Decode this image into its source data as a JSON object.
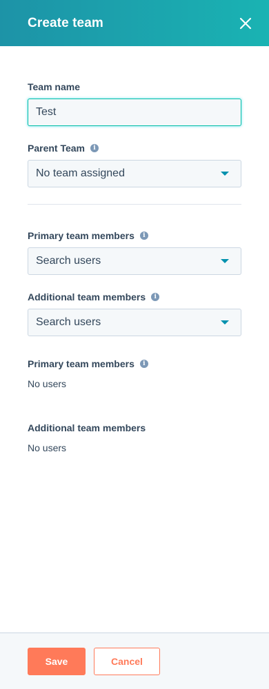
{
  "header": {
    "title": "Create team",
    "close_icon": "close-icon"
  },
  "form": {
    "team_name": {
      "label": "Team name",
      "value": "Test"
    },
    "parent_team": {
      "label": "Parent Team",
      "selected": "No team assigned",
      "info_icon": "info-icon"
    },
    "primary_members_select": {
      "label": "Primary team members",
      "placeholder": "Search users",
      "info_icon": "info-icon"
    },
    "additional_members_select": {
      "label": "Additional team members",
      "placeholder": "Search users",
      "info_icon": "info-icon"
    },
    "primary_members_list": {
      "label": "Primary team members",
      "empty_text": "No users",
      "info_icon": "info-icon"
    },
    "additional_members_list": {
      "label": "Additional team members",
      "empty_text": "No users"
    }
  },
  "footer": {
    "save_label": "Save",
    "cancel_label": "Cancel"
  },
  "colors": {
    "header_gradient_start": "#1d93a7",
    "header_gradient_end": "#1ab3b3",
    "primary_button": "#ff7a59",
    "text": "#33475b",
    "input_focus_border": "#00bda5",
    "caret": "#0091ae"
  }
}
